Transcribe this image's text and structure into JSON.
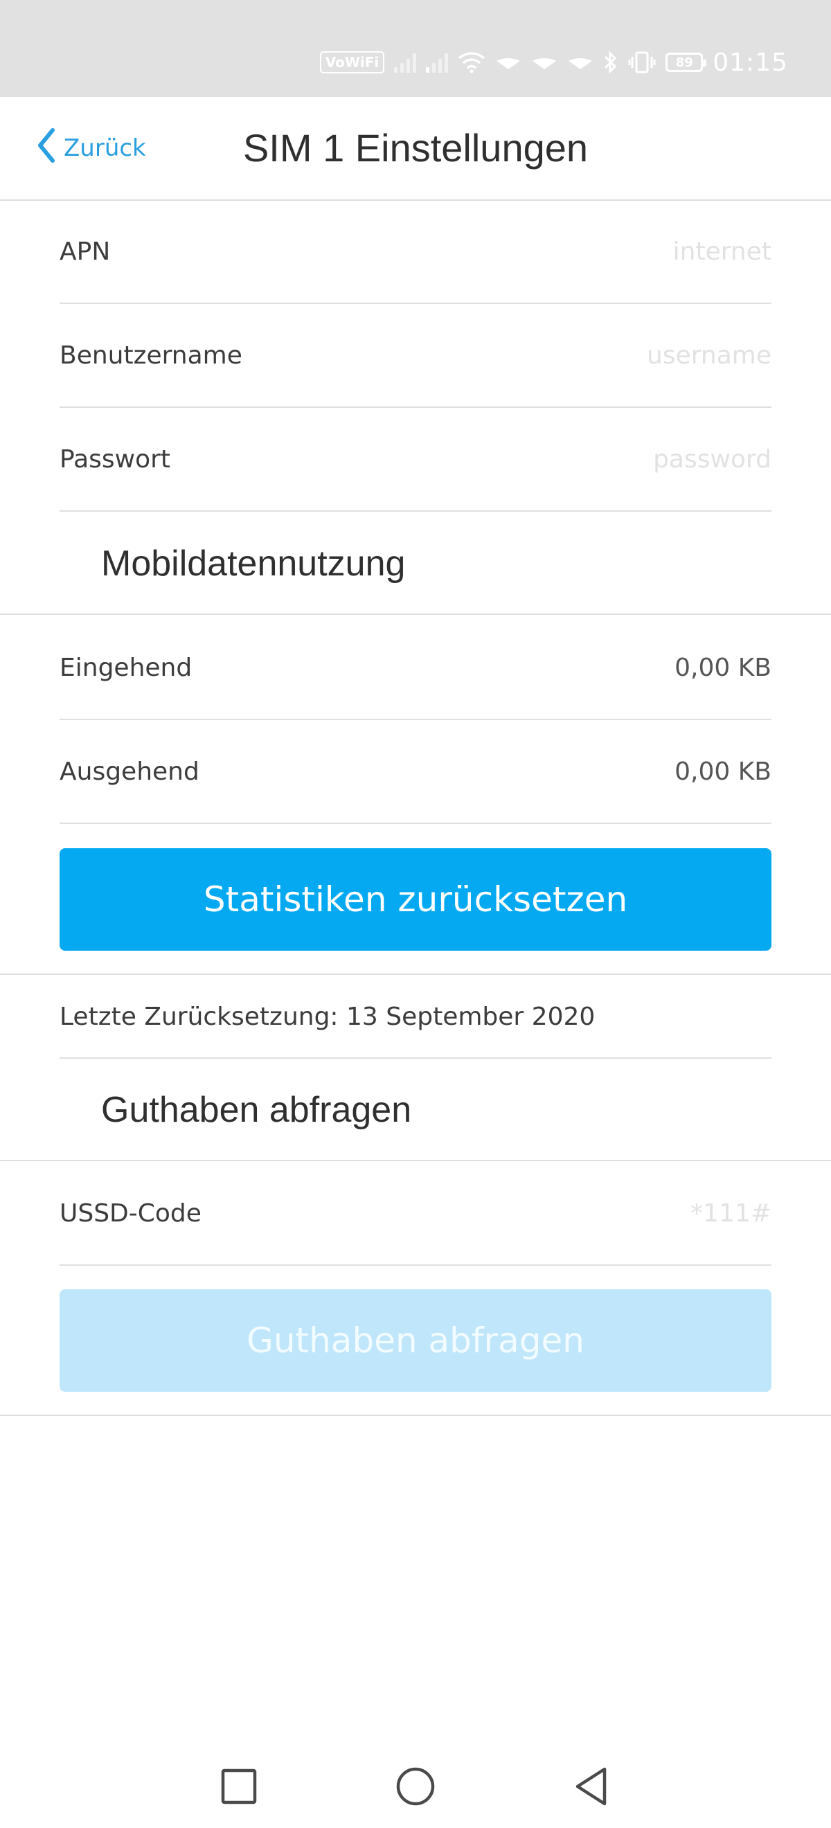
{
  "status_bar": {
    "vowifi_label": "VoWiFi",
    "battery_level": "89",
    "time": "01:15",
    "icons": [
      "vowifi-icon",
      "signal-icon",
      "signal-icon",
      "wifi-icon",
      "data-icon",
      "data-icon",
      "data-icon",
      "bluetooth-icon",
      "vibrate-icon",
      "battery-icon"
    ]
  },
  "header": {
    "back_label": "Zurück",
    "back_icon": "chevron-left-icon",
    "title": "SIM 1 Einstellungen"
  },
  "apn_settings": {
    "apn_label": "APN",
    "apn_placeholder": "internet",
    "username_label": "Benutzername",
    "username_placeholder": "username",
    "password_label": "Passwort",
    "password_placeholder": "password"
  },
  "data_usage": {
    "section_title": "Mobildatennutzung",
    "incoming_label": "Eingehend",
    "incoming_value": "0,00 KB",
    "outgoing_label": "Ausgehend",
    "outgoing_value": "0,00 KB",
    "reset_button": "Statistiken zurücksetzen",
    "last_reset": "Letzte Zurücksetzung: 13 September 2020"
  },
  "balance": {
    "section_title": "Guthaben abfragen",
    "ussd_label": "USSD-Code",
    "ussd_placeholder": "*111#",
    "query_button": "Guthaben abfragen"
  },
  "navigation_bar": {
    "icons": [
      "recent-apps-icon",
      "home-icon",
      "back-icon"
    ]
  },
  "colors": {
    "accent": "#04a9f2",
    "accent_disabled": "#bfe6fa",
    "status_bar": "#e1e1e1",
    "link": "#2a9fe0"
  }
}
